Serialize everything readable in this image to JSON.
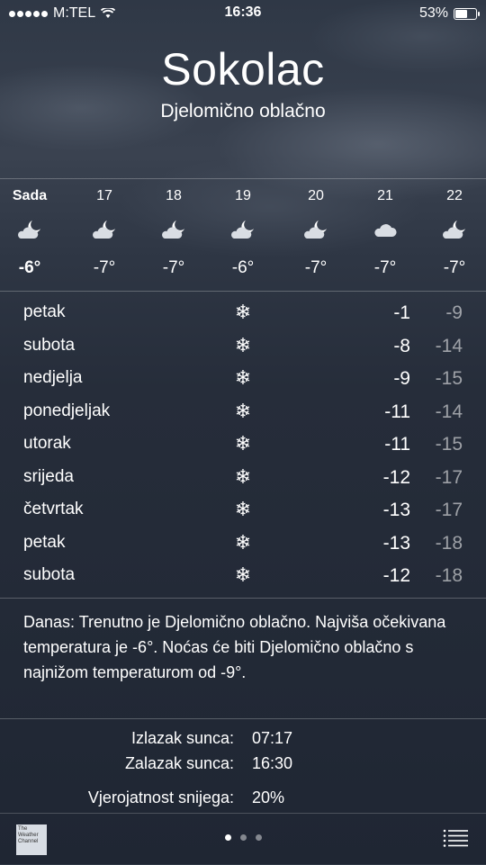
{
  "status_bar": {
    "carrier": "M:TEL",
    "time": "16:36",
    "battery": "53%",
    "battery_level": 0.53,
    "icons": [
      "signal-dots-icon",
      "wifi-icon",
      "battery-icon"
    ]
  },
  "location": {
    "city": "Sokolac",
    "condition": "Djelomično oblačno"
  },
  "hourly": [
    {
      "label": "Sada",
      "temp": "-6°",
      "icon": "partly-cloudy-night-icon",
      "bold": true
    },
    {
      "label": "17",
      "temp": "-7°",
      "icon": "partly-cloudy-night-icon"
    },
    {
      "label": "18",
      "temp": "-7°",
      "icon": "partly-cloudy-night-icon"
    },
    {
      "label": "19",
      "temp": "-6°",
      "icon": "partly-cloudy-night-icon"
    },
    {
      "label": "20",
      "temp": "-7°",
      "icon": "partly-cloudy-night-icon"
    },
    {
      "label": "21",
      "temp": "-7°",
      "icon": "cloud-icon"
    },
    {
      "label": "22",
      "temp": "-7°",
      "icon": "partly-cloudy-night-icon"
    }
  ],
  "daily": [
    {
      "day": "petak",
      "hi": "-1",
      "lo": "-9",
      "icon": "snowflake-icon"
    },
    {
      "day": "subota",
      "hi": "-8",
      "lo": "-14",
      "icon": "snowflake-icon"
    },
    {
      "day": "nedjelja",
      "hi": "-9",
      "lo": "-15",
      "icon": "snowflake-icon"
    },
    {
      "day": "ponedjeljak",
      "hi": "-11",
      "lo": "-14",
      "icon": "snowflake-icon"
    },
    {
      "day": "utorak",
      "hi": "-11",
      "lo": "-15",
      "icon": "snowflake-icon"
    },
    {
      "day": "srijeda",
      "hi": "-12",
      "lo": "-17",
      "icon": "snowflake-icon"
    },
    {
      "day": "četvrtak",
      "hi": "-13",
      "lo": "-17",
      "icon": "snowflake-icon"
    },
    {
      "day": "petak",
      "hi": "-13",
      "lo": "-18",
      "icon": "snowflake-icon"
    },
    {
      "day": "subota",
      "hi": "-12",
      "lo": "-18",
      "icon": "snowflake-icon"
    }
  ],
  "summary": "Danas: Trenutno je Djelomično oblačno. Najviša očekivana temperatura je -6°. Noćas će biti Djelomično oblačno s najnižom temperaturom od -9°.",
  "details": [
    {
      "label": "Izlazak sunca:",
      "value": "07:17"
    },
    {
      "label": "Zalazak sunca:",
      "value": "16:30"
    },
    {
      "label": "Vjerojatnost snijega:",
      "value": "20%"
    }
  ],
  "bottom_bar": {
    "logo_text": "The Weather Channel",
    "page_count": 3,
    "active_page": 1
  }
}
